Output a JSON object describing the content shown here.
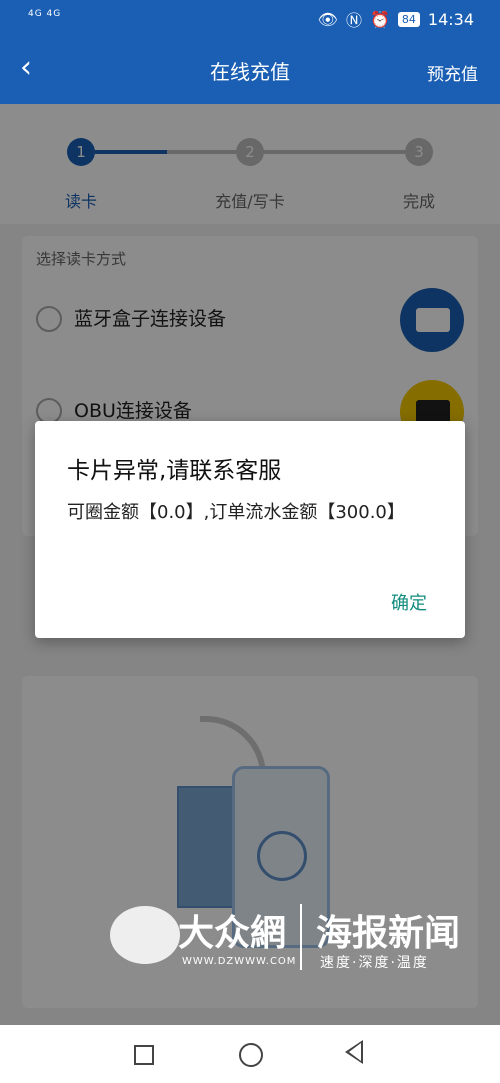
{
  "status_bar": {
    "network": "4G 4G",
    "battery": "84",
    "time": "14:34"
  },
  "header": {
    "back_icon": "chevron-left-icon",
    "title": "在线充值",
    "action": "预充值"
  },
  "steps": [
    {
      "number": "1",
      "label": "读卡",
      "active": true
    },
    {
      "number": "2",
      "label": "充值/写卡",
      "active": false
    },
    {
      "number": "3",
      "label": "完成",
      "active": false
    }
  ],
  "read_method": {
    "section_title": "选择读卡方式",
    "options": [
      {
        "label": "蓝牙盒子连接设备",
        "icon": "bluetooth-box-icon"
      },
      {
        "label": "OBU连接设备",
        "icon": "obu-device-icon"
      }
    ]
  },
  "dialog": {
    "title": "卡片异常,请联系客服",
    "message": "可圈金额【0.0】,订单流水金额【300.0】",
    "ok_label": "确定"
  },
  "watermark": {
    "brand": "大众網",
    "url": "WWW.DZWWW.COM",
    "brand2": "海报新闻",
    "slogan": "速度·深度·温度"
  },
  "colors": {
    "primary": "#1a5fb4",
    "dialog_button": "#128c7e"
  }
}
